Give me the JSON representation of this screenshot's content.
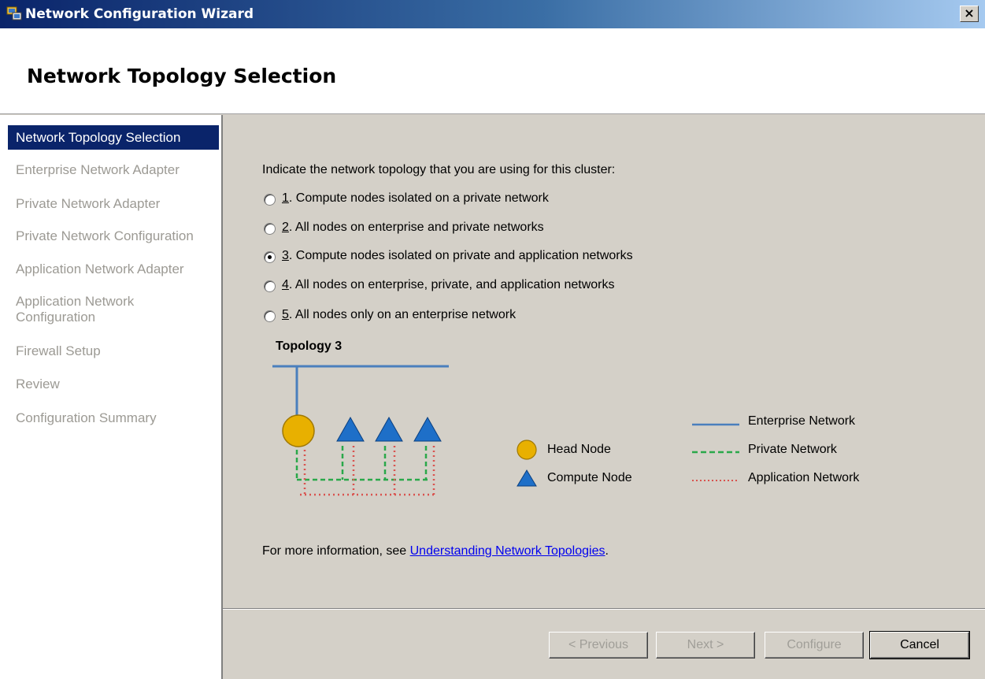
{
  "window": {
    "title": "Network Configuration Wizard",
    "close_label": "×"
  },
  "header": {
    "title": "Network Topology Selection"
  },
  "nav": {
    "items": [
      {
        "label": "Network Topology Selection",
        "state": "active"
      },
      {
        "label": "Enterprise Network Adapter",
        "state": "disabled"
      },
      {
        "label": "Private Network Adapter",
        "state": "disabled"
      },
      {
        "label": "Private Network Configuration",
        "state": "disabled"
      },
      {
        "label": "Application Network Adapter",
        "state": "disabled"
      },
      {
        "label": "Application Network Configuration",
        "state": "disabled"
      },
      {
        "label": "Firewall Setup",
        "state": "disabled"
      },
      {
        "label": "Review",
        "state": "disabled"
      },
      {
        "label": "Configuration Summary",
        "state": "disabled"
      }
    ]
  },
  "main": {
    "prompt": "Indicate the network topology that you are using for this cluster:",
    "options": [
      {
        "num": "1",
        "rest": ". Compute nodes isolated on a private network",
        "checked": false
      },
      {
        "num": "2",
        "rest": ". All nodes on enterprise and private networks",
        "checked": false
      },
      {
        "num": "3",
        "rest": ". Compute nodes isolated on private and application networks",
        "checked": true
      },
      {
        "num": "4",
        "rest": ". All nodes on enterprise, private, and application networks",
        "checked": false
      },
      {
        "num": "5",
        "rest": ". All nodes only on an enterprise network",
        "checked": false
      }
    ],
    "topology_title": "Topology 3",
    "legend": {
      "head_node": "Head Node",
      "compute_node": "Compute Node",
      "enterprise_network": "Enterprise Network",
      "private_network": "Private Network",
      "application_network": "Application Network"
    },
    "info_prefix": "For more information, see ",
    "info_link": "Understanding Network Topologies",
    "info_suffix": "."
  },
  "colors": {
    "enterprise": "#4a7fbd",
    "private": "#2aa84a",
    "application": "#d9534f",
    "head_node": "#e8b000",
    "compute_node": "#1e6fc8",
    "nav_active": "#0a246a"
  },
  "footer": {
    "previous": "< Previous",
    "next": "Next >",
    "configure": "Configure",
    "cancel": "Cancel"
  }
}
